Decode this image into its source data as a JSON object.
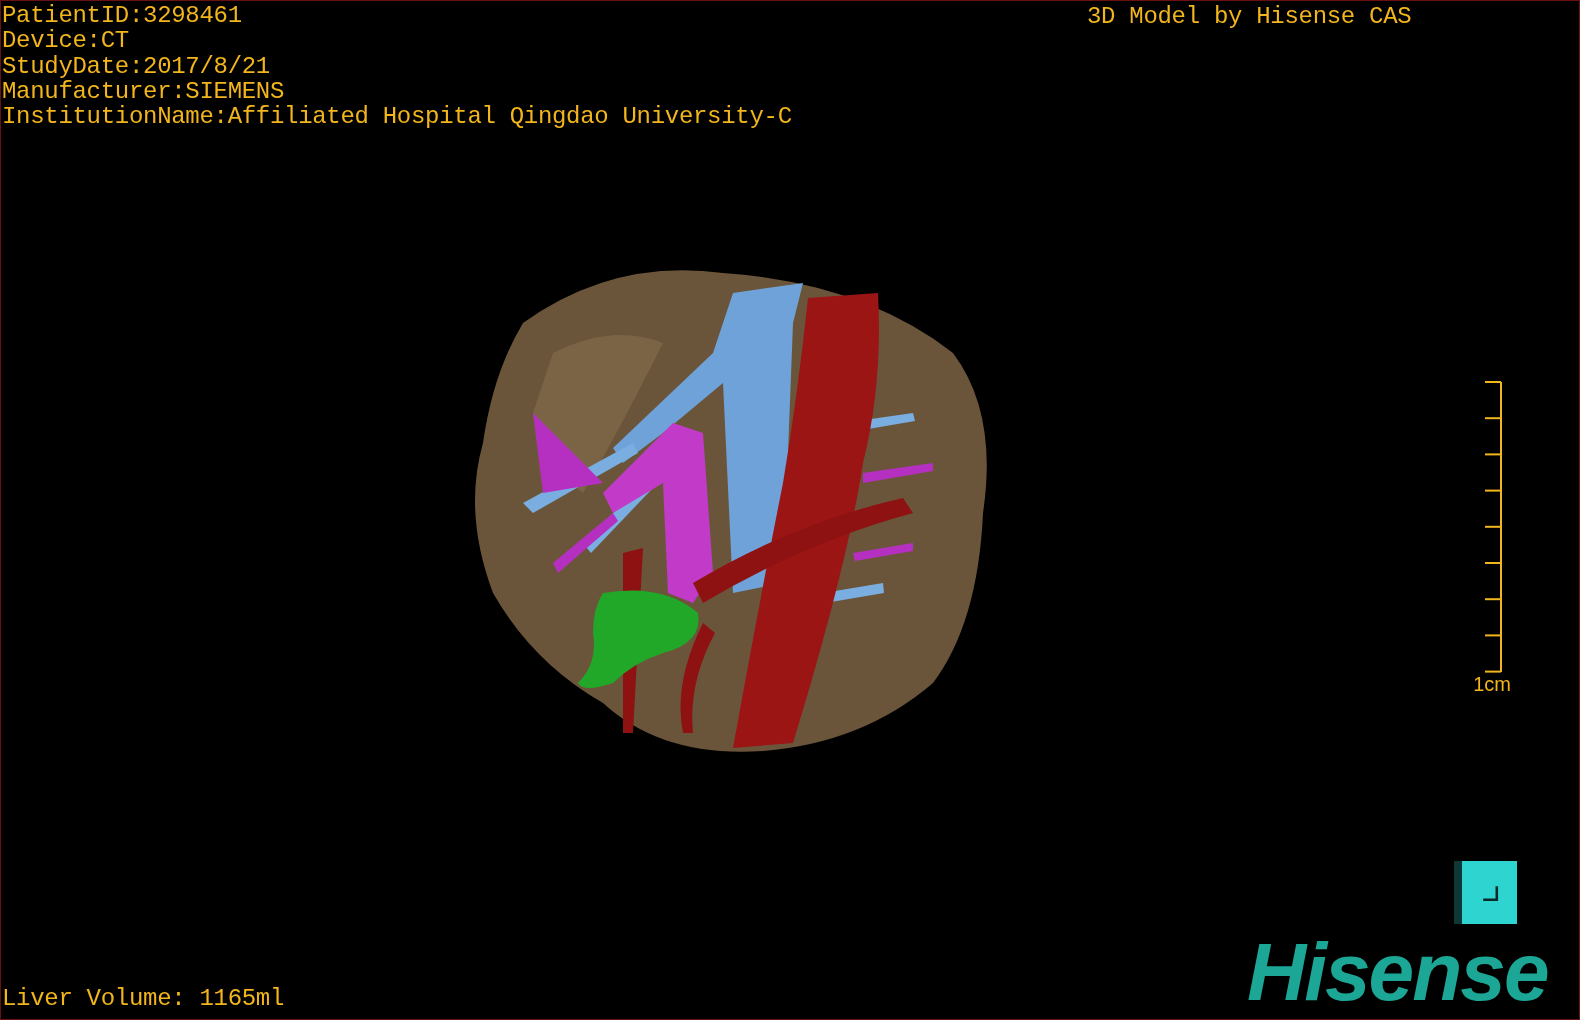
{
  "patient_info": [
    "PatientID:3298461",
    "Device:CT",
    "StudyDate:2017/8/21",
    "Manufacturer:SIEMENS",
    "InstitutionName:Affiliated Hospital Qingdao University-C"
  ],
  "caption": "3D Model by Hisense CAS",
  "scale_bar": {
    "label": "1cm"
  },
  "measurement": "Liver Volume: 1165ml",
  "logo": {
    "text": "Hisense"
  }
}
